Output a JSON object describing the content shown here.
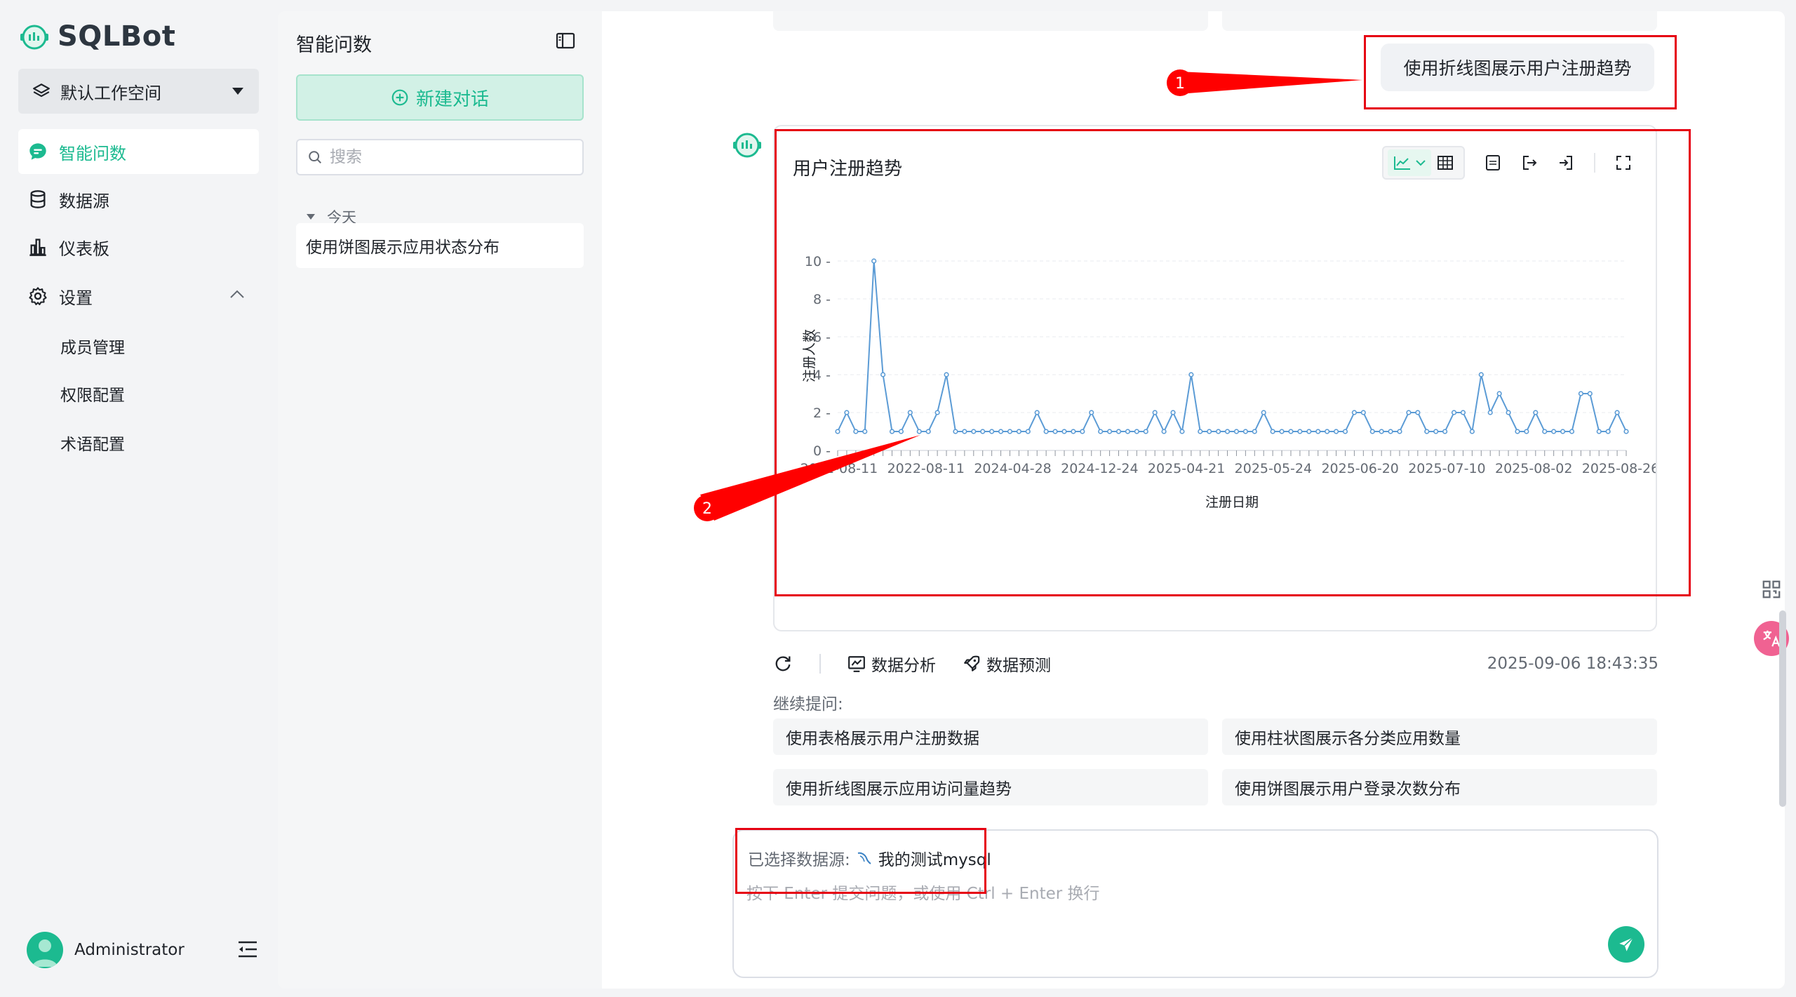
{
  "app": {
    "name": "SQLBot",
    "brand_color": "#1cba90"
  },
  "workspace": {
    "label": "默认工作空间"
  },
  "nav": {
    "items": [
      {
        "label": "智能问数",
        "icon": "chat-icon",
        "active": true
      },
      {
        "label": "数据源",
        "icon": "database-icon",
        "active": false
      },
      {
        "label": "仪表板",
        "icon": "bar-chart-icon",
        "active": false
      },
      {
        "label": "设置",
        "icon": "gear-icon",
        "active": false
      }
    ],
    "settings_children": [
      "成员管理",
      "权限配置",
      "术语配置"
    ]
  },
  "user": {
    "name": "Administrator"
  },
  "conversations": {
    "title": "智能问数",
    "new_chat_label": "新建对话",
    "search_placeholder": "搜索",
    "group_label": "今天",
    "items": [
      "使用饼图展示应用状态分布"
    ]
  },
  "chat": {
    "user_message": "使用折线图展示用户注册趋势",
    "chart_title": "用户注册趋势",
    "actions": {
      "data_analysis": "数据分析",
      "data_prediction": "数据预测"
    },
    "timestamp": "2025-09-06 18:43:35",
    "followup_label": "继续提问:",
    "followups": [
      "使用表格展示用户注册数据",
      "使用柱状图展示各分类应用数量",
      "使用折线图展示应用访问量趋势",
      "使用饼图展示用户登录次数分布"
    ]
  },
  "input": {
    "datasource_label": "已选择数据源:",
    "datasource_name": "我的测试mysql",
    "placeholder": "按下 Enter 提交问题，或使用 Ctrl + Enter 换行"
  },
  "annotations": [
    "1",
    "2"
  ],
  "chart_data": {
    "type": "line",
    "xlabel": "注册日期",
    "ylabel": "注册人数",
    "ylim": [
      0,
      10
    ],
    "yticks": [
      0,
      2,
      4,
      6,
      8,
      10
    ],
    "xtick_labels": [
      "2021-08-11",
      "2022-08-11",
      "2024-04-28",
      "2024-12-24",
      "2025-04-21",
      "2025-05-24",
      "2025-06-20",
      "2025-07-10",
      "2025-08-02",
      "2025-08-26"
    ],
    "series": [
      {
        "color": "#5b9bd5",
        "values": [
          1,
          2,
          1,
          1,
          10,
          4,
          1,
          1,
          2,
          1,
          1,
          2,
          4,
          1,
          1,
          1,
          1,
          1,
          1,
          1,
          1,
          1,
          2,
          1,
          1,
          1,
          1,
          1,
          2,
          1,
          1,
          1,
          1,
          1,
          1,
          2,
          1,
          2,
          1,
          4,
          1,
          1,
          1,
          1,
          1,
          1,
          1,
          2,
          1,
          1,
          1,
          1,
          1,
          1,
          1,
          1,
          1,
          2,
          2,
          1,
          1,
          1,
          1,
          2,
          2,
          1,
          1,
          1,
          2,
          2,
          1,
          4,
          2,
          3,
          2,
          1,
          1,
          2,
          1,
          1,
          1,
          1,
          3,
          3,
          1,
          1,
          2,
          1
        ]
      }
    ],
    "grid": true
  }
}
